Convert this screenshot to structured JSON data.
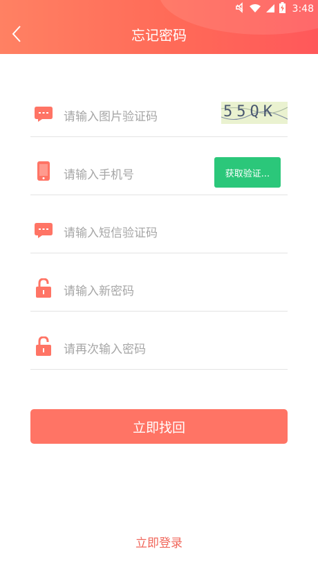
{
  "status": {
    "time": "3:48"
  },
  "header": {
    "title": "忘记密码",
    "back_icon": "chevron-left-icon"
  },
  "form": {
    "captcha_placeholder": "请输入图片验证码",
    "captcha_text": "55QK",
    "phone_placeholder": "请输入手机号",
    "get_code_label": "获取验证...",
    "sms_placeholder": "请输入短信验证码",
    "new_password_placeholder": "请输入新密码",
    "confirm_password_placeholder": "请再次输入密码"
  },
  "actions": {
    "submit_label": "立即找回",
    "login_label": "立即登录"
  },
  "colors": {
    "accent": "#ff7465",
    "button_green": "#2bc77a",
    "link": "#f0665a"
  }
}
